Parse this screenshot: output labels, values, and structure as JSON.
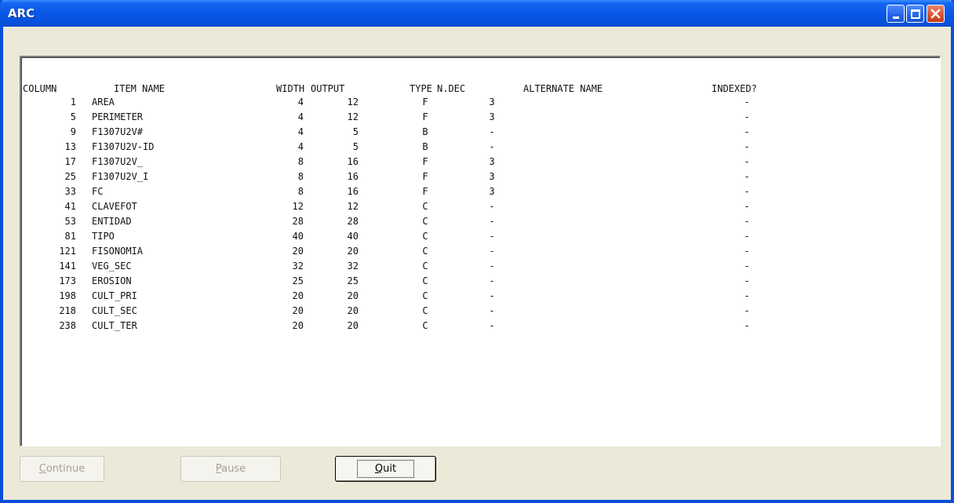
{
  "window": {
    "title": "ARC"
  },
  "titlebar_buttons": [
    {
      "icon": "minimize-icon"
    },
    {
      "icon": "maximize-icon"
    },
    {
      "icon": "close-icon"
    }
  ],
  "table": {
    "headers": {
      "column": "COLUMN",
      "item_name": "ITEM NAME",
      "width": "WIDTH",
      "output": "OUTPUT",
      "type": "TYPE",
      "ndec": "N.DEC",
      "alternate_name": "ALTERNATE NAME",
      "indexed": "INDEXED?"
    },
    "rows": [
      {
        "column": "1",
        "name": "AREA",
        "width": "4",
        "output": "12",
        "type": "F",
        "ndec": "3",
        "indexed": "-"
      },
      {
        "column": "5",
        "name": "PERIMETER",
        "width": "4",
        "output": "12",
        "type": "F",
        "ndec": "3",
        "indexed": "-"
      },
      {
        "column": "9",
        "name": "F1307U2V#",
        "width": "4",
        "output": "5",
        "type": "B",
        "ndec": "-",
        "indexed": "-"
      },
      {
        "column": "13",
        "name": "F1307U2V-ID",
        "width": "4",
        "output": "5",
        "type": "B",
        "ndec": "-",
        "indexed": "-"
      },
      {
        "column": "17",
        "name": "F1307U2V_",
        "width": "8",
        "output": "16",
        "type": "F",
        "ndec": "3",
        "indexed": "-"
      },
      {
        "column": "25",
        "name": "F1307U2V_I",
        "width": "8",
        "output": "16",
        "type": "F",
        "ndec": "3",
        "indexed": "-"
      },
      {
        "column": "33",
        "name": "FC",
        "width": "8",
        "output": "16",
        "type": "F",
        "ndec": "3",
        "indexed": "-"
      },
      {
        "column": "41",
        "name": "CLAVEFOT",
        "width": "12",
        "output": "12",
        "type": "C",
        "ndec": "-",
        "indexed": "-"
      },
      {
        "column": "53",
        "name": "ENTIDAD",
        "width": "28",
        "output": "28",
        "type": "C",
        "ndec": "-",
        "indexed": "-"
      },
      {
        "column": "81",
        "name": "TIPO",
        "width": "40",
        "output": "40",
        "type": "C",
        "ndec": "-",
        "indexed": "-"
      },
      {
        "column": "121",
        "name": "FISONOMIA",
        "width": "20",
        "output": "20",
        "type": "C",
        "ndec": "-",
        "indexed": "-"
      },
      {
        "column": "141",
        "name": "VEG_SEC",
        "width": "32",
        "output": "32",
        "type": "C",
        "ndec": "-",
        "indexed": "-"
      },
      {
        "column": "173",
        "name": "EROSION",
        "width": "25",
        "output": "25",
        "type": "C",
        "ndec": "-",
        "indexed": "-"
      },
      {
        "column": "198",
        "name": "CULT_PRI",
        "width": "20",
        "output": "20",
        "type": "C",
        "ndec": "-",
        "indexed": "-"
      },
      {
        "column": "218",
        "name": "CULT_SEC",
        "width": "20",
        "output": "20",
        "type": "C",
        "ndec": "-",
        "indexed": "-"
      },
      {
        "column": "238",
        "name": "CULT_TER",
        "width": "20",
        "output": "20",
        "type": "C",
        "ndec": "-",
        "indexed": "-"
      }
    ]
  },
  "buttons": {
    "continue": {
      "label": "Continue",
      "mnemonic": "C",
      "rest": "ontinue",
      "enabled": false
    },
    "pause": {
      "label": "Pause",
      "mnemonic": "P",
      "rest": "ause",
      "enabled": false
    },
    "quit": {
      "label": "Quit",
      "mnemonic": "Q",
      "rest": "uit",
      "enabled": true
    }
  },
  "colors": {
    "titlebar": "#0A58E6",
    "window_bg": "#ECE9D8",
    "close_button": "#D8512E"
  }
}
